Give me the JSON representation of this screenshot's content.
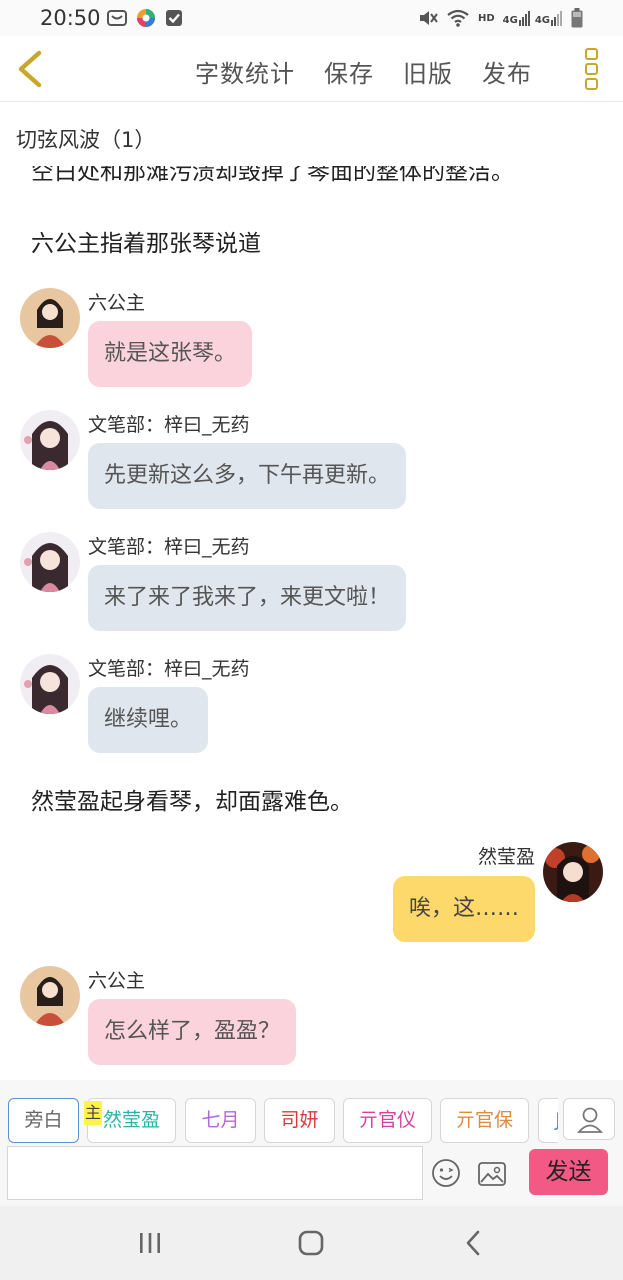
{
  "status_bar": {
    "time": "20:50",
    "network_label": "HD",
    "signal_1": "4G",
    "signal_2": "4G",
    "icons": [
      "mail-icon",
      "colorful-app-icon",
      "check-box-icon",
      "mute-icon",
      "wifi-icon",
      "signal-icon",
      "battery-icon"
    ]
  },
  "header": {
    "actions": [
      "字数统计",
      "保存",
      "旧版",
      "发布"
    ],
    "accent_color": "#c8a82a"
  },
  "chapter": {
    "title": "切弦风波（1）"
  },
  "content": {
    "cut_line": "空白处和那滩污渍却毁掉了琴面的整体的整洁。",
    "narration_1": "六公主指着那张琴说道",
    "messages": [
      {
        "speaker": "六公主",
        "text": "就是这张琴。"
      },
      {
        "speaker": "文笔部：梓曰_无药",
        "text": "先更新这么多，下午再更新。"
      },
      {
        "speaker": "文笔部：梓曰_无药",
        "text": "来了来了我来了，来更文啦！"
      },
      {
        "speaker": "文笔部：梓曰_无药",
        "text": "继续哩。"
      }
    ],
    "narration_2": "然莹盈起身看琴，却面露难色。",
    "right_message": {
      "speaker": "然莹盈",
      "text": "唉，这……"
    },
    "last_message": {
      "speaker": "六公主",
      "text": "怎么样了，盈盈？"
    }
  },
  "composer": {
    "main_badge": "主",
    "chips": [
      {
        "label": "旁白",
        "color": "#666666"
      },
      {
        "label": "然莹盈",
        "color": "#2bb3a8"
      },
      {
        "label": "七月",
        "color": "#b06ad8"
      },
      {
        "label": "司妍",
        "color": "#d83a3a"
      },
      {
        "label": "亓官仪",
        "color": "#d8409a"
      },
      {
        "label": "亓官保",
        "color": "#e08a3a"
      },
      {
        "label": "J",
        "color": "#4a8ad8"
      }
    ],
    "input_value": "",
    "send_label": "发送",
    "send_color": "#f25a85"
  },
  "nav": [
    "recent-apps-icon",
    "home-icon",
    "back-icon"
  ]
}
